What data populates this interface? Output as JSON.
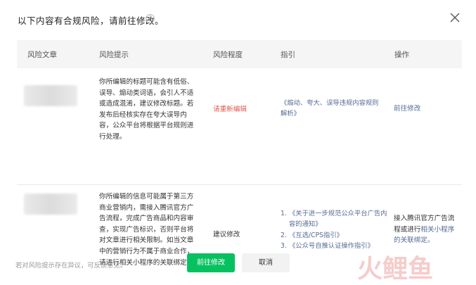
{
  "dialog": {
    "title": "以下内容有合规风险，请前往修改。",
    "help_icon": "?",
    "close_icon": "close-icon"
  },
  "table": {
    "headers": {
      "article": "风险文章",
      "hint": "风险提示",
      "level": "风险程度",
      "guide": "指引",
      "action": "操作"
    },
    "rows": [
      {
        "hint": "你所编辑的标题可能含有低俗、误导、煽动类词语，会引人不适或造成混淆，建议修改标题。若发布后经核实存在夸大误导内容，公众平台将根据平台规则进行处理。",
        "level": "请重新编辑",
        "guide": "《煽动、夸大、误导违规内容规则解析》",
        "action": "前往修改"
      },
      {
        "hint": "你所编辑的信息可能属于第三方商业营销内，需接入腾讯官方广告流程，完成广告商品和内容审查，实现广告标识，否则平台将对文章进行相关限制。如当文章中的营销行为不属于商业合作，请进行相关小程序的关联绑定。",
        "level": "建议修改",
        "guides": [
          {
            "num": "1.",
            "text": "《关于进一步规范公众平台广告内容的通知》"
          },
          {
            "num": "2.",
            "text": "《互选/CPS指引》"
          },
          {
            "num": "3.",
            "text": "《公众号自推认证操作指引》"
          }
        ],
        "action_text": "接入腾讯官方广告流程或进行",
        "action_link": "相关小程序的关联绑定。"
      }
    ]
  },
  "footer": {
    "note": "若对风险提示存在异议，可反馈意见。",
    "primary_button": "前往修改",
    "cancel_button": "取消"
  },
  "colors": {
    "primary": "#07c160",
    "link": "#576b95",
    "danger": "#e35b4c",
    "header_bg": "#f5f5f5"
  },
  "watermark": "火鲤鱼"
}
